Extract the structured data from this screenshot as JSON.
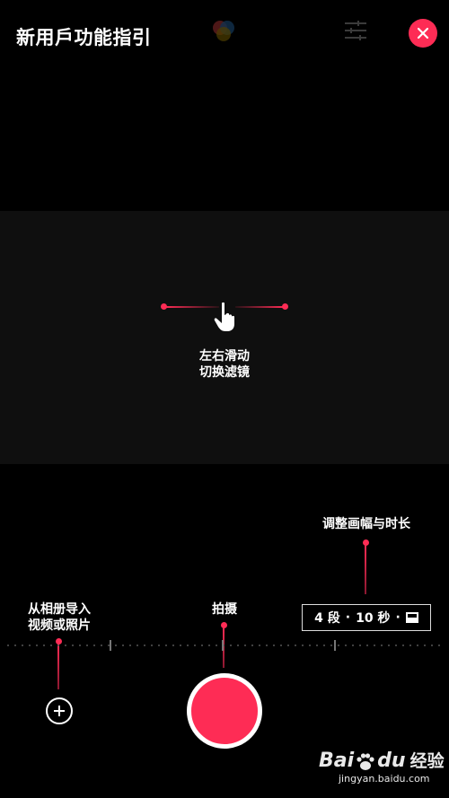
{
  "header": {
    "title": "新用戶功能指引",
    "close_icon": "close-icon",
    "filter_icon": "sliders-icon",
    "accent_color": "#fe2c55"
  },
  "preview": {
    "swipe_hint_line1": "左右滑动",
    "swipe_hint_line2": "切换滤镜",
    "hand_icon": "pointing-hand-icon"
  },
  "guides": {
    "duration_hint": "调整画幅与时长",
    "shoot_hint": "拍摄",
    "import_hint_line1": "从相册导入",
    "import_hint_line2": "视频或照片"
  },
  "duration_selector": {
    "segments": "4 段",
    "separator": "·",
    "seconds": "10 秒",
    "aspect_icon": "aspect-ratio-icon"
  },
  "controls": {
    "record_button": "record-button",
    "import_icon": "plus-circle-icon"
  },
  "watermark": {
    "brand": "Bai",
    "brand_tail": "du",
    "service": "经验",
    "url": "jingyan.baidu.com"
  }
}
